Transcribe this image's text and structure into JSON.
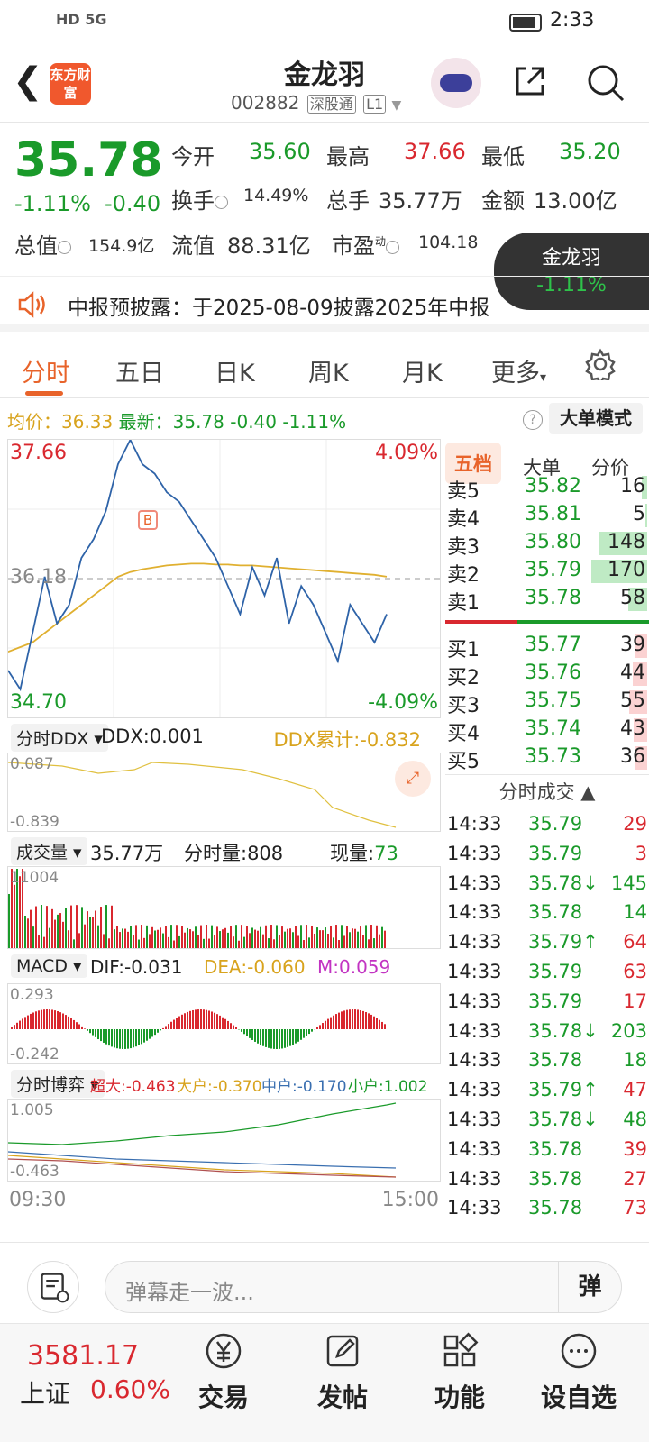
{
  "status": {
    "time": "2:33",
    "net": "HD 5G"
  },
  "header": {
    "back_label": "<",
    "logo_text": "东方财富",
    "name": "金龙羽",
    "code": "002882",
    "tag1": "深股通",
    "tag2": "L1"
  },
  "quote": {
    "price": "35.78",
    "chg_pct": "-1.11%",
    "chg": "-0.40",
    "open_l": "今开",
    "open": "35.60",
    "high_l": "最高",
    "high": "37.66",
    "low_l": "最低",
    "low": "35.20",
    "turn_l": "换手",
    "turn": "14.49%",
    "vol_l": "总手",
    "vol": "35.77万",
    "amt_l": "金额",
    "amt": "13.00亿",
    "cap_l": "总值",
    "cap": "154.9亿",
    "float_l": "流值",
    "float": "88.31亿",
    "pe_l": "市盈",
    "pe_sup": "动",
    "pe": "104.18"
  },
  "floater": {
    "name": "金龙羽",
    "pct": "-1.11%"
  },
  "notice": {
    "text": "中报预披露：于2025-08-09披露2025年中报"
  },
  "tabs": [
    "分时",
    "五日",
    "日K",
    "周K",
    "月K",
    "更多"
  ],
  "avgline": {
    "avg_label": "均价：",
    "avg": "36.33",
    "last_label": "最新：",
    "last": "35.78",
    "chg": "-0.40",
    "pct": "-1.11%"
  },
  "bigmode": "大单模式",
  "chart": {
    "ymax": "37.66",
    "ymin": "34.70",
    "pmax": "4.09%",
    "pmin": "-4.09%",
    "base": "36.18",
    "buy_mark": "B",
    "ddx_sel": "分时DDX",
    "ddx": "DDX:0.001",
    "ddx_cum": "DDX累计:-0.832",
    "ddx_top": "0.087",
    "ddx_bot": "-0.839",
    "vol_sel": "成交量",
    "vol_total": "35.77万",
    "vol_min": "分时量:808",
    "vol_now_l": "现量:",
    "vol_now": "73",
    "vol_max": "11004",
    "macd_sel": "MACD",
    "dif": "DIF:-0.031",
    "dea": "DEA:-0.060",
    "m": "M:0.059",
    "macd_top": "0.293",
    "macd_bot": "-0.242",
    "game_sel": "分时博弈",
    "super": "超大:-0.463",
    "big": "大户:-0.370",
    "mid": "中户:-0.170",
    "small": "小户:1.002",
    "game_top": "1.005",
    "game_bot": "-0.463",
    "t_start": "09:30",
    "t_end": "15:00",
    "chart_data": {
      "type": "line",
      "x_range": [
        "09:30",
        "15:00"
      ],
      "ylim": [
        34.7,
        37.66
      ],
      "base": 36.18,
      "price": [
        35.2,
        35.0,
        35.6,
        36.2,
        35.7,
        35.9,
        36.4,
        36.6,
        36.9,
        37.4,
        37.66,
        37.4,
        37.3,
        37.1,
        37.0,
        36.8,
        36.6,
        36.4,
        36.1,
        35.8,
        36.3,
        36.0,
        36.4,
        35.7,
        36.1,
        35.9,
        35.6,
        35.3,
        35.9,
        35.7,
        35.5,
        35.8
      ],
      "avg": [
        35.4,
        35.45,
        35.5,
        35.6,
        35.7,
        35.8,
        35.9,
        36.0,
        36.1,
        36.2,
        36.25,
        36.28,
        36.3,
        36.32,
        36.33,
        36.34,
        36.34,
        36.33,
        36.33,
        36.32,
        36.32,
        36.31,
        36.3,
        36.29,
        36.28,
        36.27,
        36.26,
        36.25,
        36.24,
        36.23,
        36.22,
        36.2
      ]
    }
  },
  "book": {
    "tabs": [
      "五档",
      "大单",
      "分价"
    ],
    "asks": [
      {
        "k": "卖5",
        "p": "35.82",
        "v": "16",
        "w": 0.1
      },
      {
        "k": "卖4",
        "p": "35.81",
        "v": "5",
        "w": 0.03
      },
      {
        "k": "卖3",
        "p": "35.80",
        "v": "148",
        "w": 0.87
      },
      {
        "k": "卖2",
        "p": "35.79",
        "v": "170",
        "w": 1.0
      },
      {
        "k": "卖1",
        "p": "35.78",
        "v": "58",
        "w": 0.34
      }
    ],
    "bids": [
      {
        "k": "买1",
        "p": "35.77",
        "v": "39",
        "w": 0.23
      },
      {
        "k": "买2",
        "p": "35.76",
        "v": "44",
        "w": 0.26
      },
      {
        "k": "买3",
        "p": "35.75",
        "v": "55",
        "w": 0.32
      },
      {
        "k": "买4",
        "p": "35.74",
        "v": "43",
        "w": 0.25
      },
      {
        "k": "买5",
        "p": "35.73",
        "v": "36",
        "w": 0.21
      }
    ],
    "trades_title": "分时成交",
    "trades": [
      {
        "t": "14:33",
        "p": "35.79",
        "v": "29",
        "c": "red"
      },
      {
        "t": "14:33",
        "p": "35.79",
        "v": "3",
        "c": "red"
      },
      {
        "t": "14:33",
        "p": "35.78↓",
        "v": "145",
        "c": "green"
      },
      {
        "t": "14:33",
        "p": "35.78",
        "v": "14",
        "c": "green"
      },
      {
        "t": "14:33",
        "p": "35.79↑",
        "v": "64",
        "c": "red"
      },
      {
        "t": "14:33",
        "p": "35.79",
        "v": "63",
        "c": "red"
      },
      {
        "t": "14:33",
        "p": "35.79",
        "v": "17",
        "c": "red"
      },
      {
        "t": "14:33",
        "p": "35.78↓",
        "v": "203",
        "c": "green"
      },
      {
        "t": "14:33",
        "p": "35.78",
        "v": "18",
        "c": "green"
      },
      {
        "t": "14:33",
        "p": "35.79↑",
        "v": "47",
        "c": "red"
      },
      {
        "t": "14:33",
        "p": "35.78↓",
        "v": "48",
        "c": "green"
      },
      {
        "t": "14:33",
        "p": "35.78",
        "v": "39",
        "c": "red"
      },
      {
        "t": "14:33",
        "p": "35.78",
        "v": "27",
        "c": "red"
      },
      {
        "t": "14:33",
        "p": "35.78",
        "v": "73",
        "c": "red"
      }
    ]
  },
  "input": {
    "placeholder": "弹幕走一波...",
    "danmu": "弹"
  },
  "bottom": {
    "index_val": "3581.17",
    "index_name": "上证",
    "index_pct": "0.60%",
    "nav": [
      "交易",
      "发帖",
      "功能",
      "设自选"
    ]
  }
}
